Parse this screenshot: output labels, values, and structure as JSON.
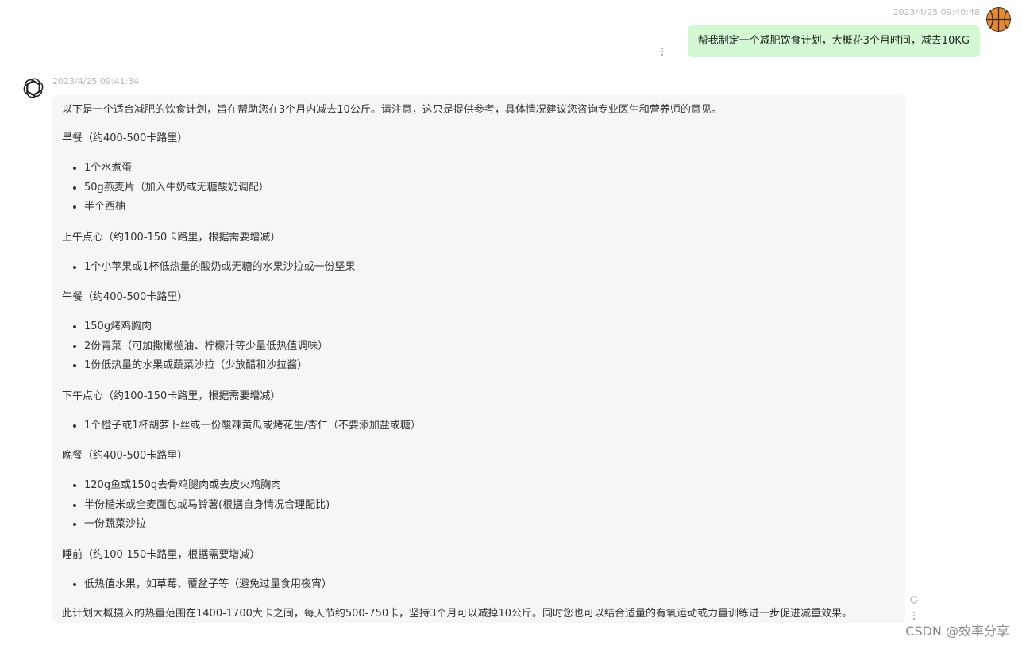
{
  "user_message": {
    "timestamp": "2023/4/25 09:40:48",
    "text": "帮我制定一个减肥饮食计划，大概花3个月时间，减去10KG",
    "avatar_icon": "basketball-icon"
  },
  "bot_message": {
    "timestamp": "2023/4/25 09:41:34",
    "avatar_icon": "openai-logo-icon",
    "intro": "以下是一个适合减肥的饮食计划，旨在帮助您在3个月内减去10公斤。请注意，这只是提供参考，具体情况建议您咨询专业医生和营养师的意见。",
    "sections": [
      {
        "heading": "早餐（约400-500卡路里）",
        "items": [
          "1个水煮蛋",
          "50g燕麦片（加入牛奶或无糖酸奶调配）",
          "半个西柚"
        ]
      },
      {
        "heading": "上午点心（约100-150卡路里，根据需要增减）",
        "items": [
          "1个小苹果或1杯低热量的酸奶或无糖的水果沙拉或一份坚果"
        ]
      },
      {
        "heading": "午餐（约400-500卡路里）",
        "items": [
          "150g烤鸡胸肉",
          "2份青菜（可加撒橄榄油、柠檬汁等少量低热值调味）",
          "1份低热量的水果或蔬菜沙拉（少放醋和沙拉酱）"
        ]
      },
      {
        "heading": "下午点心（约100-150卡路里，根据需要增减）",
        "items": [
          "1个橙子或1杯胡萝卜丝或一份酸辣黄瓜或烤花生/杏仁（不要添加盐或糖）"
        ]
      },
      {
        "heading": "晚餐（约400-500卡路里）",
        "items": [
          "120g鱼或150g去骨鸡腿肉或去皮火鸡胸肉",
          "半份糙米或全麦面包或马铃薯(根据自身情况合理配比)",
          "一份蔬菜沙拉"
        ]
      },
      {
        "heading": "睡前（约100-150卡路里，根据需要增减）",
        "items": [
          "低热值水果，如草莓、覆盆子等（避免过量食用夜宵）"
        ]
      }
    ],
    "closing": "此计划大概摄入的热量范围在1400-1700大卡之间，每天节约500-750卡，坚持3个月可以减掉10公斤。同时您也可以结合适量的有氧运动或力量训练进一步促进减重效果。"
  },
  "watermark": "CSDN @效率分享",
  "colors": {
    "user_bubble": "#d2f9d1",
    "bot_bubble": "#f4f6f8",
    "timestamp": "#b9b9b9"
  }
}
